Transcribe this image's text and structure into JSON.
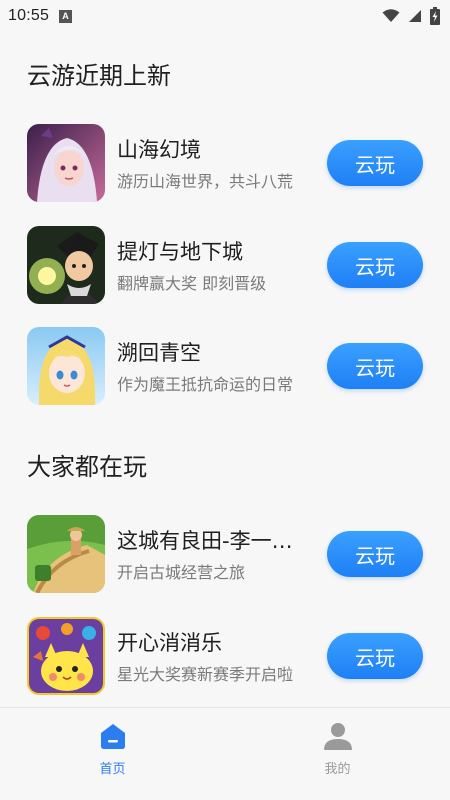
{
  "status_bar": {
    "time": "10:55",
    "notification_icon": "a-notification-icon",
    "wifi_icon": "wifi-icon",
    "signal_icon": "cell-signal-icon",
    "battery_icon": "battery-charging-icon"
  },
  "sections": [
    {
      "title": "云游近期上新",
      "games": [
        {
          "name": "山海幻境",
          "desc": "游历山海世界，共斗八荒",
          "button": "云玩"
        },
        {
          "name": "提灯与地下城",
          "desc": "翻牌赢大奖 即刻晋级",
          "button": "云玩"
        },
        {
          "name": "溯回青空",
          "desc": "作为魔王抵抗命运的日常",
          "button": "云玩"
        }
      ]
    },
    {
      "title": "大家都在玩",
      "games": [
        {
          "name": "这城有良田-李一桐代言",
          "desc": "开启古城经营之旅",
          "button": "云玩"
        },
        {
          "name": "开心消消乐",
          "desc": "星光大奖赛新赛季开启啦",
          "button": "云玩"
        }
      ]
    }
  ],
  "tab_bar": {
    "tabs": [
      {
        "label": "首页",
        "icon": "home-icon",
        "active": true
      },
      {
        "label": "我的",
        "icon": "profile-icon",
        "active": false
      }
    ]
  },
  "colors": {
    "accent": "#2b7df0",
    "button_top": "#3aa0ff",
    "button_bottom": "#1f7ff5",
    "background": "#f7f7f7"
  }
}
